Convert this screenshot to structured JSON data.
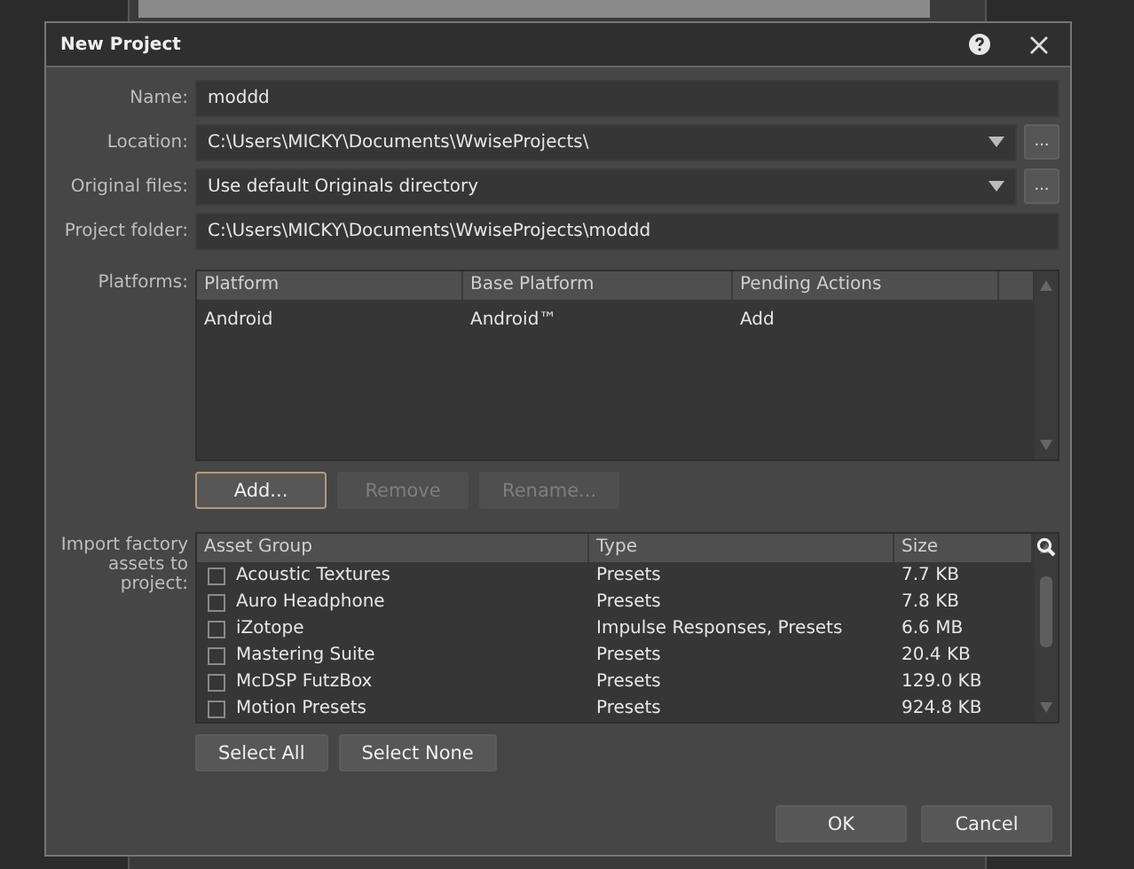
{
  "window": {
    "title": "New Project"
  },
  "fields": [
    {
      "label": "Name:",
      "value": "moddd",
      "kind": "text"
    },
    {
      "label": "Location:",
      "value": "C:\\Users\\MICKY\\Documents\\WwiseProjects\\",
      "kind": "dropdown"
    },
    {
      "label": "Original files:",
      "value": "Use default Originals directory",
      "kind": "dropdown"
    },
    {
      "label": "Project folder:",
      "value": "C:\\Users\\MICKY\\Documents\\WwiseProjects\\moddd",
      "kind": "text"
    }
  ],
  "browse_button": "...",
  "platforms": {
    "label": "Platforms:",
    "columns": [
      "Platform",
      "Base Platform",
      "Pending Actions"
    ],
    "rows": [
      {
        "cells": [
          "Android",
          "Android™",
          "Add"
        ]
      }
    ],
    "buttons": [
      {
        "label": "Add...",
        "disabled": false,
        "focused": true
      },
      {
        "label": "Remove",
        "disabled": true,
        "focused": false
      },
      {
        "label": "Rename...",
        "disabled": true,
        "focused": false
      }
    ]
  },
  "assets": {
    "label": "Import factory assets to project:",
    "columns": [
      "Asset Group",
      "Type",
      "Size"
    ],
    "rows": [
      {
        "name": "Acoustic Textures",
        "type": "Presets",
        "size": "7.7 KB",
        "checked": false
      },
      {
        "name": "Auro Headphone",
        "type": "Presets",
        "size": "7.8 KB",
        "checked": false
      },
      {
        "name": "iZotope",
        "type": "Impulse Responses, Presets",
        "size": "6.6 MB",
        "checked": false
      },
      {
        "name": "Mastering Suite",
        "type": "Presets",
        "size": "20.4 KB",
        "checked": false
      },
      {
        "name": "McDSP FutzBox",
        "type": "Presets",
        "size": "129.0 KB",
        "checked": false
      },
      {
        "name": "Motion Presets",
        "type": "Presets",
        "size": "924.8 KB",
        "checked": false
      }
    ],
    "buttons": [
      {
        "label": "Select All"
      },
      {
        "label": "Select None"
      }
    ]
  },
  "footer_buttons": [
    {
      "label": "OK"
    },
    {
      "label": "Cancel"
    }
  ]
}
